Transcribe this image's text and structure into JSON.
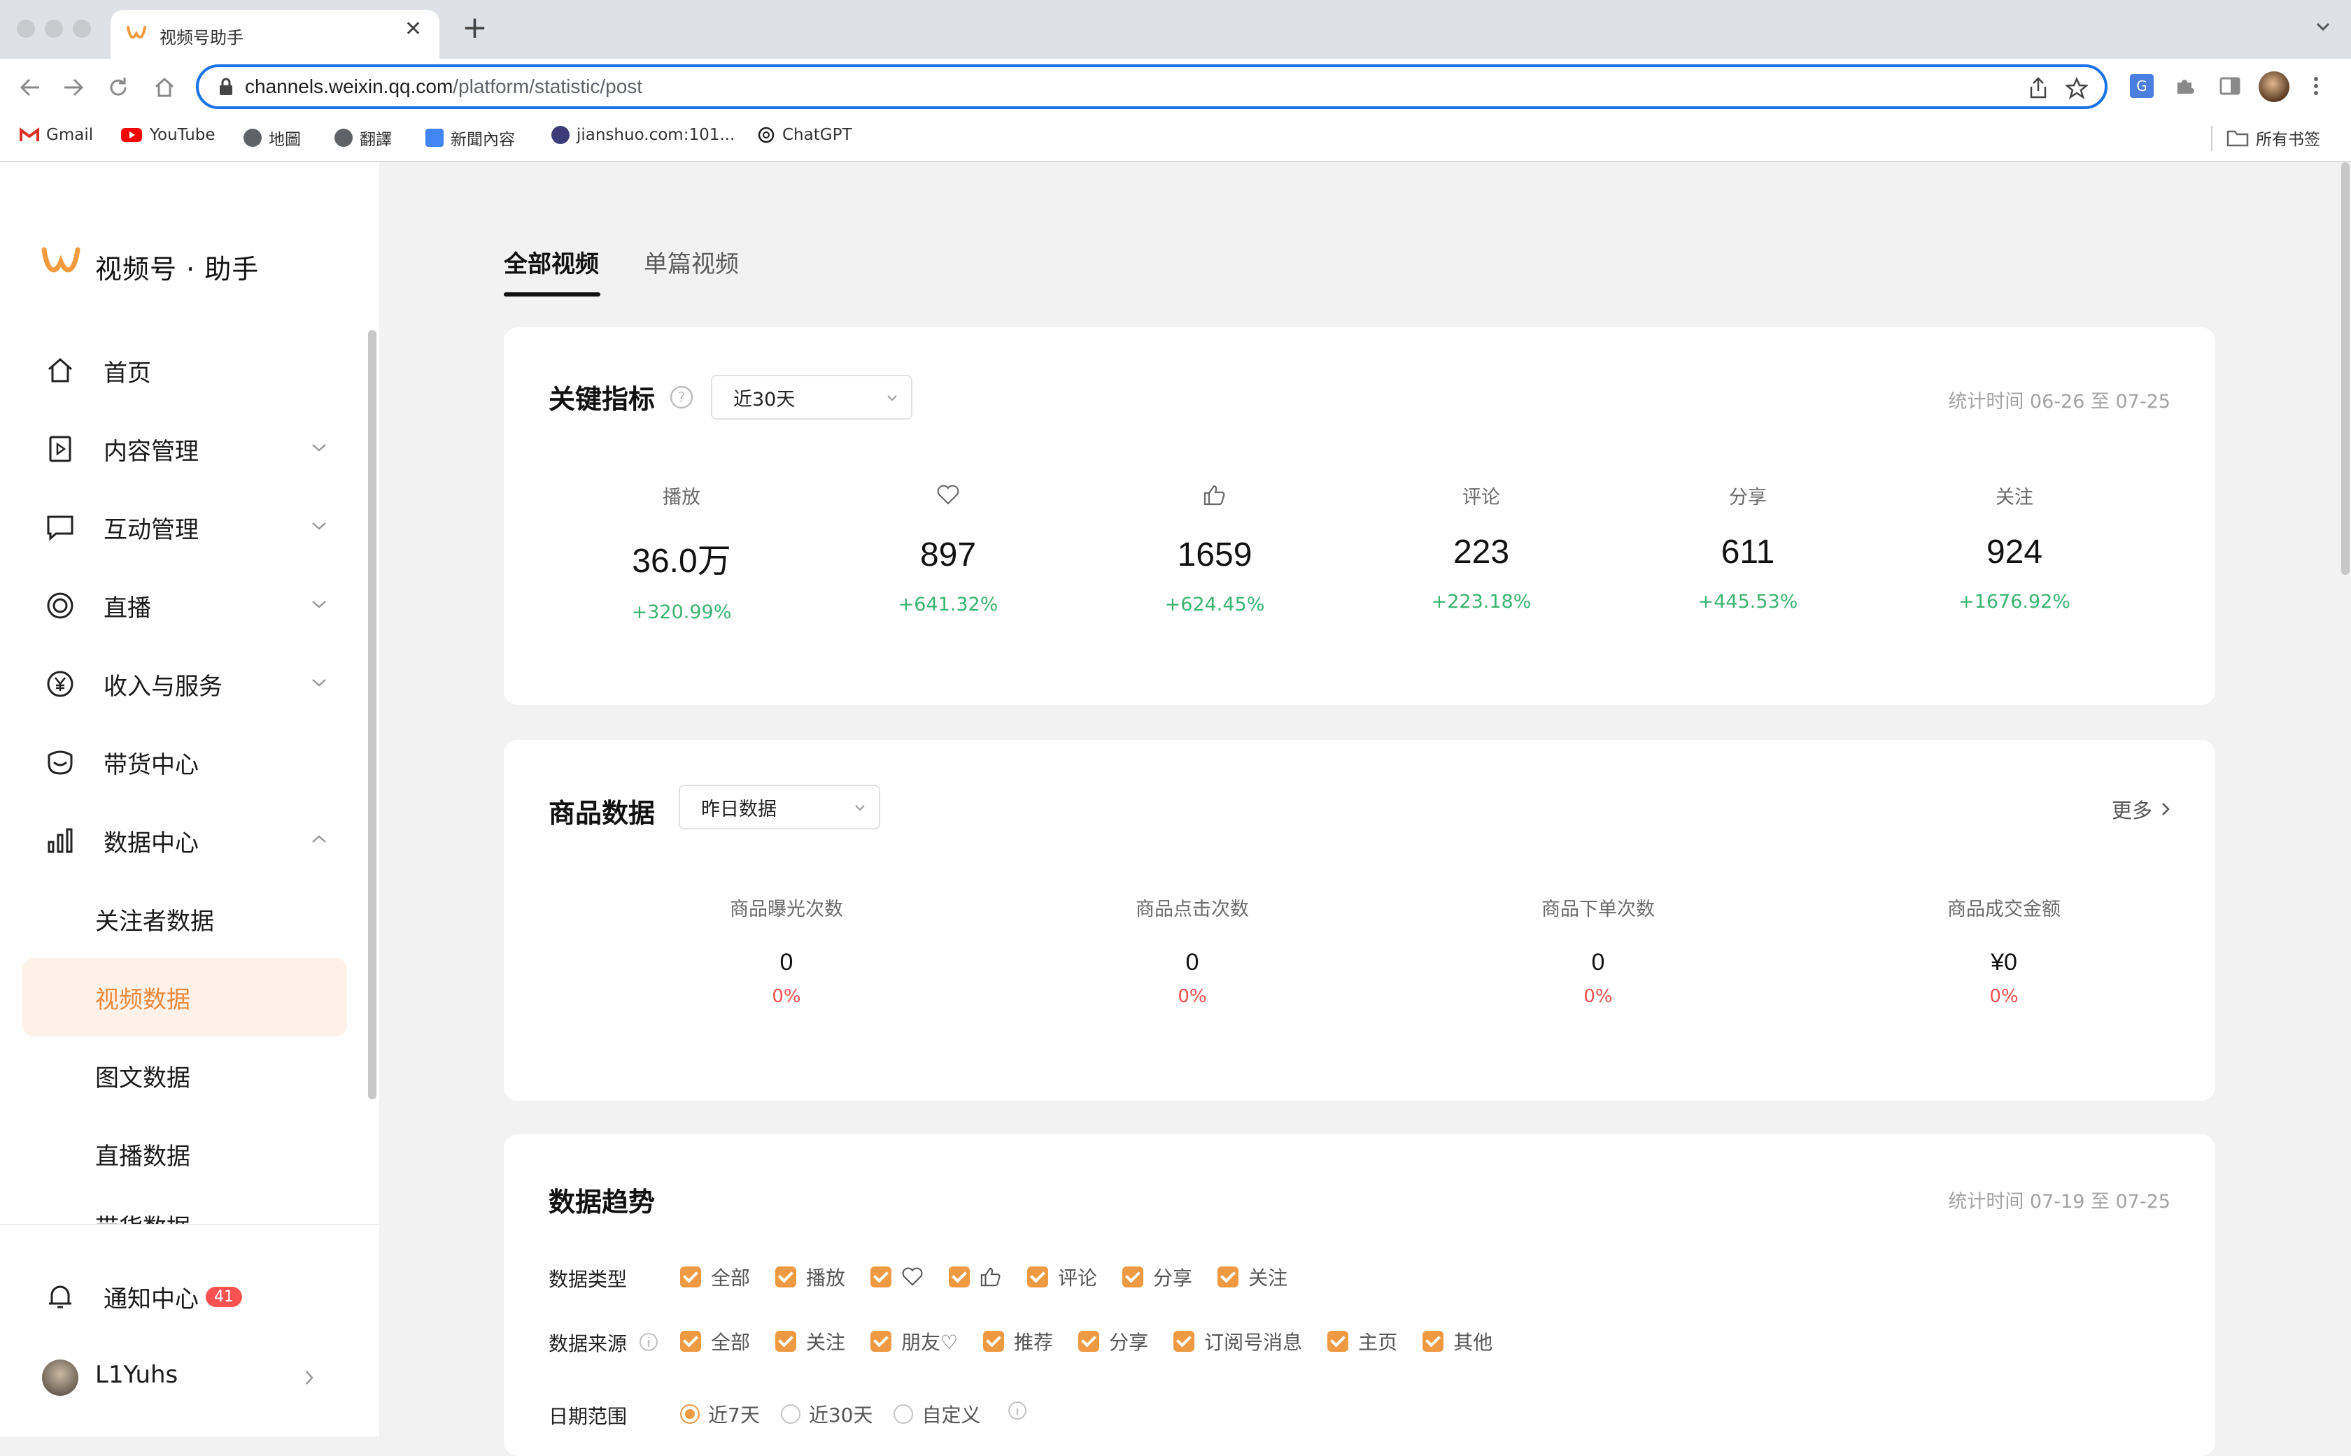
{
  "browser": {
    "tab_title": "视频号助手",
    "url_host": "channels.weixin.qq.com",
    "url_path": "/platform/statistic/post",
    "bookmarks": [
      {
        "label": "Gmail",
        "icon": "gmail-icon",
        "color": "#d93025"
      },
      {
        "label": "YouTube",
        "icon": "youtube-icon",
        "color": "#ff0000"
      },
      {
        "label": "地圖",
        "icon": "globe-icon",
        "color": "#5f6368"
      },
      {
        "label": "翻譯",
        "icon": "globe-icon",
        "color": "#5f6368"
      },
      {
        "label": "新聞內容",
        "icon": "news-icon",
        "color": "#4285f4"
      },
      {
        "label": "jianshuo.com:101...",
        "icon": "jianshuo-icon",
        "color": "#3c3c78"
      },
      {
        "label": "ChatGPT",
        "icon": "chatgpt-icon",
        "color": "#222222"
      }
    ],
    "all_bookmarks": "所有书签"
  },
  "sidebar": {
    "logo_text": "视频号 · 助手",
    "brand_color": "#f19a3e",
    "items": [
      {
        "label": "首页",
        "icon": "home-icon"
      },
      {
        "label": "内容管理",
        "icon": "content-icon"
      },
      {
        "label": "互动管理",
        "icon": "comment-icon"
      },
      {
        "label": "直播",
        "icon": "live-icon"
      },
      {
        "label": "收入与服务",
        "icon": "yen-icon"
      },
      {
        "label": "带货中心",
        "icon": "shop-icon"
      },
      {
        "label": "数据中心",
        "icon": "bar-chart-icon"
      }
    ],
    "sub_items": [
      {
        "label": "关注者数据"
      },
      {
        "label": "视频数据"
      },
      {
        "label": "图文数据"
      },
      {
        "label": "直播数据"
      },
      {
        "label": "带货数据"
      }
    ],
    "notifications": {
      "label": "通知中心",
      "count": "41"
    },
    "user": {
      "name": "L1Yuhs"
    }
  },
  "main": {
    "tabs": [
      "全部视频",
      "单篇视频"
    ],
    "key_metrics": {
      "title": "关键指标",
      "range": "近30天",
      "stat_time": "统计时间 06-26 至 07-25",
      "delta_color": "#3cb371",
      "metrics": [
        {
          "label": "播放",
          "icon": "",
          "value": "36.0万",
          "delta": "+320.99%"
        },
        {
          "label": "",
          "icon": "heart-icon",
          "value": "897",
          "delta": "+641.32%"
        },
        {
          "label": "",
          "icon": "thumb-up-icon",
          "value": "1659",
          "delta": "+624.45%"
        },
        {
          "label": "评论",
          "icon": "",
          "value": "223",
          "delta": "+223.18%"
        },
        {
          "label": "分享",
          "icon": "",
          "value": "611",
          "delta": "+445.53%"
        },
        {
          "label": "关注",
          "icon": "",
          "value": "924",
          "delta": "+1676.92%"
        }
      ]
    },
    "product_data": {
      "title": "商品数据",
      "range": "昨日数据",
      "more": "更多",
      "metrics": [
        {
          "label": "商品曝光次数",
          "value": "0",
          "delta": "0%"
        },
        {
          "label": "商品点击次数",
          "value": "0",
          "delta": "0%"
        },
        {
          "label": "商品下单次数",
          "value": "0",
          "delta": "0%"
        },
        {
          "label": "商品成交金额",
          "value": "¥0",
          "delta": "0%"
        }
      ]
    },
    "trend": {
      "title": "数据趋势",
      "stat_time": "统计时间 07-19 至 07-25",
      "data_type_label": "数据类型",
      "data_types": [
        {
          "label": "全部",
          "icon": ""
        },
        {
          "label": "播放",
          "icon": ""
        },
        {
          "label": "",
          "icon": "heart-icon"
        },
        {
          "label": "",
          "icon": "thumb-up-icon"
        },
        {
          "label": "评论",
          "icon": ""
        },
        {
          "label": "分享",
          "icon": ""
        },
        {
          "label": "关注",
          "icon": ""
        }
      ],
      "source_label": "数据来源",
      "sources": [
        "全部",
        "关注",
        "朋友♡",
        "推荐",
        "分享",
        "订阅号消息",
        "主页",
        "其他"
      ],
      "date_label": "日期范围",
      "date_options": [
        {
          "label": "近7天",
          "selected": true
        },
        {
          "label": "近30天",
          "selected": false
        },
        {
          "label": "自定义",
          "selected": false
        }
      ],
      "check_color": "#ee9a43"
    }
  }
}
